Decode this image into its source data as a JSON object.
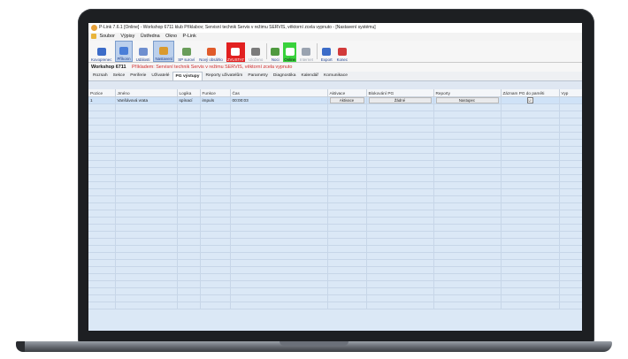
{
  "window": {
    "title": "P-Link 7.6.1 [Online] - Workshop 6711 klub Příklabov; Servisní technik Servis v režimu SERVIS, věktorní zcela vypnuto - [Nastavení systému]"
  },
  "menu": {
    "items": [
      "Soubor",
      "Výpisy",
      "Ústředna",
      "Okno",
      "P-Link"
    ]
  },
  "toolbar": {
    "buttons": [
      {
        "label": "Kovoprenec",
        "color": "#3c6cc8"
      },
      {
        "label": "Příkonn",
        "color": "#4a7ed8"
      },
      {
        "label": "Události",
        "color": "#6f8fcf"
      },
      {
        "label": "Nastavení",
        "color": "#d99a2e"
      },
      {
        "label": "SP suroví",
        "color": "#6a9d5a"
      },
      {
        "label": "Nový obsáhlo",
        "color": "#e05b2a"
      },
      {
        "label": "ZVUSTAT",
        "color": "#ffffff"
      },
      {
        "label": "Uloženo",
        "color": "#7b7b7b"
      },
      {
        "label": "Noci",
        "color": "#4f9a3f"
      },
      {
        "label": "Online",
        "color": "#ffffff"
      },
      {
        "label": "Internet",
        "color": "#9aa3b0"
      },
      {
        "label": "Export",
        "color": "#3c6cc8"
      },
      {
        "label": "Konec",
        "color": "#d23a3a"
      }
    ]
  },
  "status": {
    "workshop": "Workshop 6711",
    "message": "Příkladem: Servisní technik Servis v režimu SERVIS, věktorní zcela vypnuto"
  },
  "tabs": [
    "Rozsah",
    "Sekce",
    "Periferie",
    "Uživatelé",
    "PG výstupy",
    "Reporty uživatelům",
    "Parametry",
    "Diagnostika",
    "Kalendář",
    "Komunikace"
  ],
  "selected_tab": "PG výstupy",
  "grid": {
    "columns": [
      "Pozice",
      "Jméno",
      "Logika",
      "Funkce",
      "Čas",
      "Aktivace",
      "Blokování PG",
      "Reporty",
      "Záznam PG do paměti",
      "Vyp"
    ],
    "rows": [
      {
        "pozice": "1",
        "jmeno": "Vanšávová vrata",
        "logika": "spínací",
        "funkce": "impuls",
        "cas": "00:00:03",
        "aktivace": "Aktivace",
        "blokovani": "Žádné",
        "reporty": "Nastupec",
        "zaznam": "☑"
      }
    ],
    "empty_rows": 29
  }
}
